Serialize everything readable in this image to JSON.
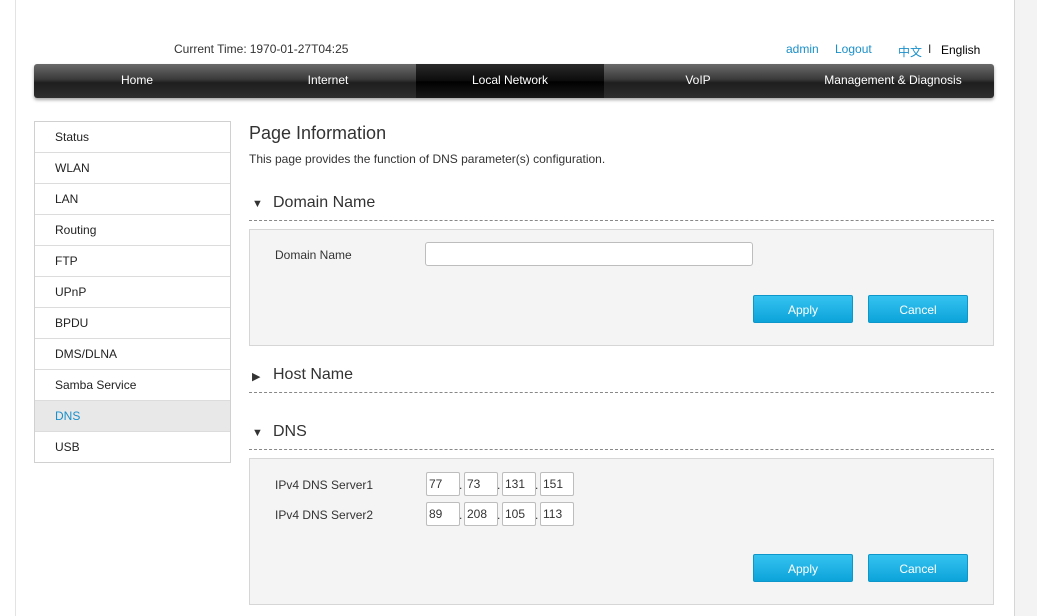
{
  "header": {
    "current_time_label": "Current Time:",
    "current_time_value": "1970-01-27T04:25",
    "user": "admin",
    "logout": "Logout",
    "lang_cn": "中文",
    "lang_sep": "I",
    "lang_en": "English"
  },
  "nav": {
    "items": [
      {
        "label": "Home"
      },
      {
        "label": "Internet"
      },
      {
        "label": "Local Network"
      },
      {
        "label": "VoIP"
      },
      {
        "label": "Management & Diagnosis"
      }
    ],
    "active": "Local Network"
  },
  "sidebar": {
    "items": [
      {
        "label": "Status"
      },
      {
        "label": "WLAN"
      },
      {
        "label": "LAN"
      },
      {
        "label": "Routing"
      },
      {
        "label": "FTP"
      },
      {
        "label": "UPnP"
      },
      {
        "label": "BPDU"
      },
      {
        "label": "DMS/DLNA"
      },
      {
        "label": "Samba Service"
      },
      {
        "label": "DNS"
      },
      {
        "label": "USB"
      }
    ],
    "active": "DNS"
  },
  "page": {
    "title": "Page Information",
    "description": "This page provides the function of DNS parameter(s) configuration."
  },
  "domain_section": {
    "title": "Domain Name",
    "expanded_arrow": "▼",
    "field_label": "Domain Name",
    "field_value": "",
    "apply": "Apply",
    "cancel": "Cancel"
  },
  "host_section": {
    "title": "Host Name",
    "collapsed_arrow": "▶"
  },
  "dns_section": {
    "title": "DNS",
    "expanded_arrow": "▼",
    "server1_label": "IPv4 DNS Server1",
    "server1": [
      "77",
      "73",
      "131",
      "151"
    ],
    "server2_label": "IPv4 DNS Server2",
    "server2": [
      "89",
      "208",
      "105",
      "113"
    ],
    "dot": ".",
    "apply": "Apply",
    "cancel": "Cancel"
  },
  "colors": {
    "accent": "#1a8fc9",
    "button": "#18b0e6",
    "nav_bg": "#2e2e2e"
  }
}
